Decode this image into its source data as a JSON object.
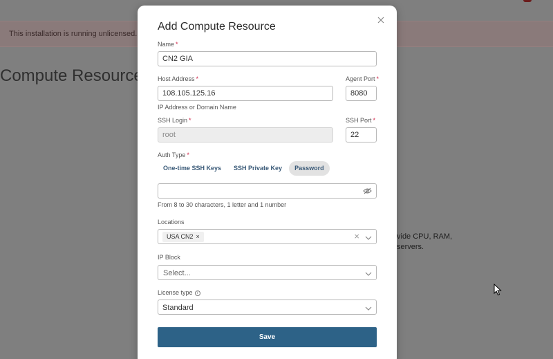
{
  "background": {
    "banner_text": "This installation is running unlicensed.",
    "heading": "Compute Resources",
    "description": "vide CPU, RAM, servers."
  },
  "modal": {
    "title": "Add Compute Resource",
    "name": {
      "label": "Name",
      "value": "CN2 GIA"
    },
    "host_address": {
      "label": "Host Address",
      "value": "108.105.125.16",
      "hint": "IP Address or Domain Name"
    },
    "agent_port": {
      "label": "Agent Port",
      "value": "8080"
    },
    "ssh_login": {
      "label": "SSH Login",
      "value": "root"
    },
    "ssh_port": {
      "label": "SSH Port",
      "value": "22"
    },
    "auth_type": {
      "label": "Auth Type",
      "options": [
        "One-time SSH Keys",
        "SSH Private Key",
        "Password"
      ],
      "selected": "Password"
    },
    "password": {
      "value": "",
      "hint": "From 8 to 30 characters, 1 letter and 1 number"
    },
    "locations": {
      "label": "Locations",
      "selected": [
        "USA CN2"
      ]
    },
    "ip_block": {
      "label": "IP Block",
      "placeholder": "Select..."
    },
    "license_type": {
      "label": "License type",
      "value": "Standard"
    },
    "save_label": "Save"
  },
  "colors": {
    "primary": "#2d6287",
    "required": "#d0284b",
    "tab_text": "#3a5a78"
  }
}
